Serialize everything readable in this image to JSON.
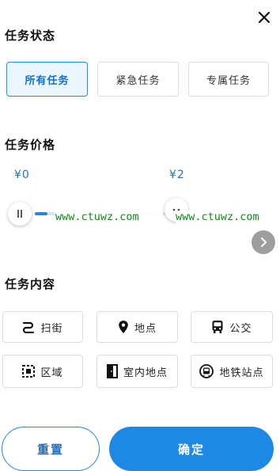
{
  "status_section": {
    "title": "任务状态",
    "options": [
      "所有任务",
      "紧急任务",
      "专属任务"
    ],
    "selected_index": 0
  },
  "price_section": {
    "title": "任务价格",
    "min_label": "¥0",
    "max_label": "¥2"
  },
  "watermark": {
    "left": "www.ctuwz.com",
    "right": "www.ctuwz.com"
  },
  "content_section": {
    "title": "任务内容",
    "items": [
      {
        "label": "扫街",
        "icon": "sweep-street-icon"
      },
      {
        "label": "地点",
        "icon": "location-pin-icon"
      },
      {
        "label": "公交",
        "icon": "bus-icon"
      },
      {
        "label": "区域",
        "icon": "area-icon"
      },
      {
        "label": "室内地点",
        "icon": "indoor-door-icon"
      },
      {
        "label": "地铁站点",
        "icon": "subway-icon"
      }
    ]
  },
  "footer": {
    "reset_label": "重置",
    "confirm_label": "确定"
  },
  "colors": {
    "accent": "#1e88e5",
    "selected_bg": "#eaf5fd",
    "watermark": "#0f8a16",
    "next_button": "#9e9e9e"
  }
}
